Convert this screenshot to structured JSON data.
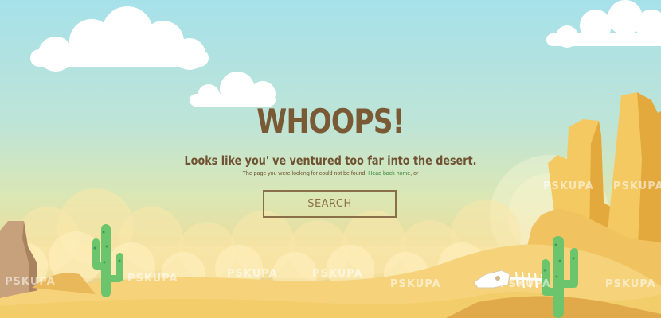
{
  "page": {
    "title": "WHOOPS!",
    "subtitle": "Looks like you' ve ventured too far into the desert.",
    "note_text": "The page you were looking for could not be found.",
    "home_link": "Head back home",
    "note_suffix": ", or",
    "search_label": "SEARCH"
  },
  "watermark": "PSKUPA",
  "colors": {
    "title": "#7a5a34",
    "link": "#3f8a3f",
    "button_border": "#8a7048",
    "cactus": "#6cc46c",
    "sand": "#f2cd6a"
  }
}
